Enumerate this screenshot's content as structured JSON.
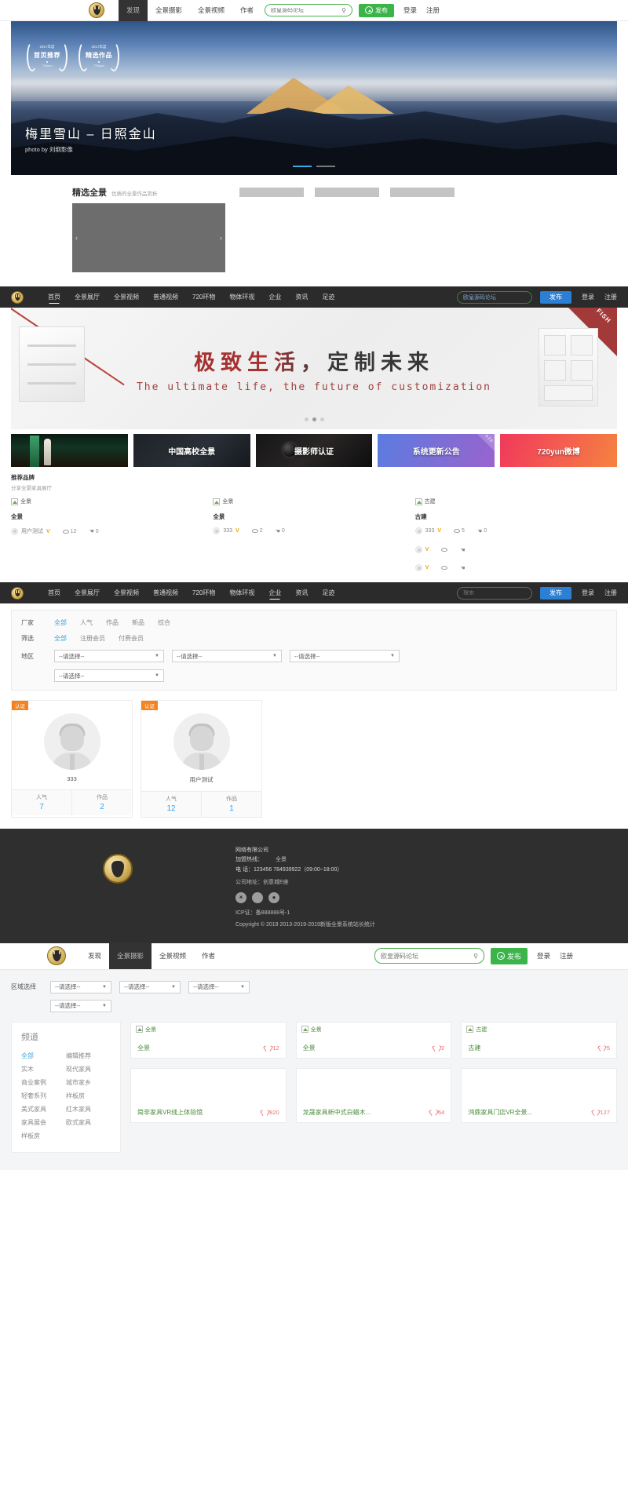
{
  "topnav": {
    "logo": "shield-logo",
    "items": [
      {
        "label": "发现",
        "active": true
      },
      {
        "label": "全景摄影",
        "active": false
      },
      {
        "label": "全景视频",
        "active": false
      },
      {
        "label": "作者",
        "active": false
      }
    ],
    "search_placeholder": "欧皇源码论坛",
    "search_icon": "search-icon",
    "publish_label": "发布",
    "login_label": "登录",
    "register_label": "注册"
  },
  "hero": {
    "badges": [
      {
        "year": "2017年度",
        "title": "首页推荐",
        "brand": "720yun"
      },
      {
        "year": "2017年度",
        "title": "精选作品",
        "brand": "720yun"
      }
    ],
    "title": "梅里雪山 – 日照金山",
    "credit": "photo by 刘纲影像",
    "dots": 2,
    "active_dot": 0
  },
  "featured": {
    "title": "精选全景",
    "subtitle": "优质的全景作品赏析",
    "prev_icon": "chevron-left-icon",
    "next_icon": "chevron-right-icon",
    "thumbs": 3
  },
  "darknav": {
    "items": [
      {
        "label": "首页",
        "active": true
      },
      {
        "label": "全景展厅",
        "active": false
      },
      {
        "label": "全景视频",
        "active": false
      },
      {
        "label": "普通视频",
        "active": false
      },
      {
        "label": "720环物",
        "active": false
      },
      {
        "label": "物体环视",
        "active": false
      },
      {
        "label": "企业",
        "active": false
      },
      {
        "label": "资讯",
        "active": false
      },
      {
        "label": "足迹",
        "active": false
      }
    ],
    "search_value": "欧皇源码论坛",
    "publish_label": "发布",
    "login_label": "登录",
    "register_label": "注册"
  },
  "fbanner": {
    "corner_label": "FISH",
    "title": "极致生活，定制未来",
    "subtitle": "The ultimate life, the future of customization",
    "dots": 3,
    "active_dot": 1
  },
  "promos": [
    {
      "label": "",
      "style": "rocket",
      "version": ""
    },
    {
      "label": "中国高校全景",
      "style": "dark2",
      "version": ""
    },
    {
      "label": "摄影师认证",
      "style": "dark3",
      "version": ""
    },
    {
      "label": "系统更新公告",
      "style": "purple",
      "version": "4.2.0"
    },
    {
      "label": "720yun微博",
      "style": "pinkred",
      "version": ""
    }
  ],
  "brands": {
    "title": "推荐品牌",
    "subtitle": "分享全景家具展厅",
    "items": [
      {
        "alt": "全景",
        "name": "全景",
        "author": "用户测试",
        "verified": "V",
        "views": "12",
        "likes": "0"
      },
      {
        "alt": "全景",
        "name": "全景",
        "author": "333",
        "verified": "V",
        "views": "2",
        "likes": "0"
      },
      {
        "alt": "古建",
        "name": "古建",
        "author": "333",
        "verified": "V",
        "views": "5",
        "likes": "0"
      }
    ],
    "row2": [
      {
        "verified": "V"
      },
      {
        "verified": "V"
      }
    ]
  },
  "darknav2": {
    "items": [
      {
        "label": "首页",
        "active": false
      },
      {
        "label": "全景展厅",
        "active": false
      },
      {
        "label": "全景视频",
        "active": false
      },
      {
        "label": "普通视频",
        "active": false
      },
      {
        "label": "720环物",
        "active": false
      },
      {
        "label": "物体环视",
        "active": false
      },
      {
        "label": "企业",
        "active": true
      },
      {
        "label": "资讯",
        "active": false
      },
      {
        "label": "足迹",
        "active": false
      }
    ],
    "search_placeholder": "搜索",
    "publish_label": "发布",
    "login_label": "登录",
    "register_label": "注册"
  },
  "filters": {
    "rows": [
      {
        "label": "厂家",
        "options": [
          {
            "text": "全部",
            "on": true
          },
          {
            "text": "人气",
            "on": false
          },
          {
            "text": "作品",
            "on": false
          },
          {
            "text": "新品",
            "on": false
          },
          {
            "text": "综合",
            "on": false
          }
        ]
      },
      {
        "label": "筛选",
        "options": [
          {
            "text": "全部",
            "on": true
          },
          {
            "text": "注册会员",
            "on": false
          },
          {
            "text": "付费会员",
            "on": false
          }
        ]
      }
    ],
    "region_label": "地区",
    "selects": [
      "--请选择--",
      "--请选择--",
      "--请选择--"
    ],
    "select4": "--请选择--"
  },
  "usercards": [
    {
      "cert": "认证",
      "name": "333",
      "stat1_label": "人气",
      "stat1_value": "7",
      "stat2_label": "作品",
      "stat2_value": "2"
    },
    {
      "cert": "认证",
      "name": "用户测试",
      "stat1_label": "人气",
      "stat1_value": "12",
      "stat2_label": "作品",
      "stat2_value": "1"
    }
  ],
  "footer": {
    "company": "网络有限公司",
    "hotline_label": "加盟热线：",
    "hotline_value": "全景",
    "phone": "电 话：123456 784939922（09:00~18:00）",
    "address": "公司地址：创意城E座",
    "socials": [
      "wechat-icon",
      "weibo-icon",
      "qq-icon"
    ],
    "icp": "ICP证：备888888号-1",
    "copyright": "Copyright © 2019 2013-2019-2019新版全景系统站长统计"
  },
  "section4": {
    "nav": {
      "items": [
        {
          "label": "发现",
          "active": false
        },
        {
          "label": "全景摄影",
          "active": true
        },
        {
          "label": "全景视频",
          "active": false
        },
        {
          "label": "作者",
          "active": false
        }
      ],
      "search_placeholder": "欧皇源码论坛",
      "publish_label": "发布",
      "login_label": "登录",
      "register_label": "注册"
    },
    "region_label": "区域选择",
    "selects": [
      "--请选择--",
      "--请选择--",
      "--请选择--"
    ],
    "select4": "--请选择--",
    "channel": {
      "title": "频道",
      "items": [
        {
          "label": "全部",
          "on": true
        },
        {
          "label": "编辑推荐",
          "on": false
        },
        {
          "label": "实木",
          "on": false
        },
        {
          "label": "现代家具",
          "on": false
        },
        {
          "label": "商业案例",
          "on": false
        },
        {
          "label": "城市家乡",
          "on": false
        },
        {
          "label": "轻奢系列",
          "on": false
        },
        {
          "label": "样板房",
          "on": false
        },
        {
          "label": "美式家具",
          "on": false
        },
        {
          "label": "红木家具",
          "on": false
        },
        {
          "label": "家具展会",
          "on": false
        },
        {
          "label": "欧式家具",
          "on": false
        },
        {
          "label": "样板房",
          "on": false
        }
      ]
    },
    "cards_row1": [
      {
        "alt": "全景",
        "title": "全景",
        "likes": "12"
      },
      {
        "alt": "全景",
        "title": "全景",
        "likes": "2"
      },
      {
        "alt": "古建",
        "title": "古建",
        "likes": "5"
      }
    ],
    "cards_row2": [
      {
        "title": "简非家具VR线上体验馆",
        "likes": "820"
      },
      {
        "title": "龙晟家具新中式白蜡木...",
        "likes": "64"
      },
      {
        "title": "鸿鼎家具门店VR全景...",
        "likes": "127"
      }
    ]
  }
}
